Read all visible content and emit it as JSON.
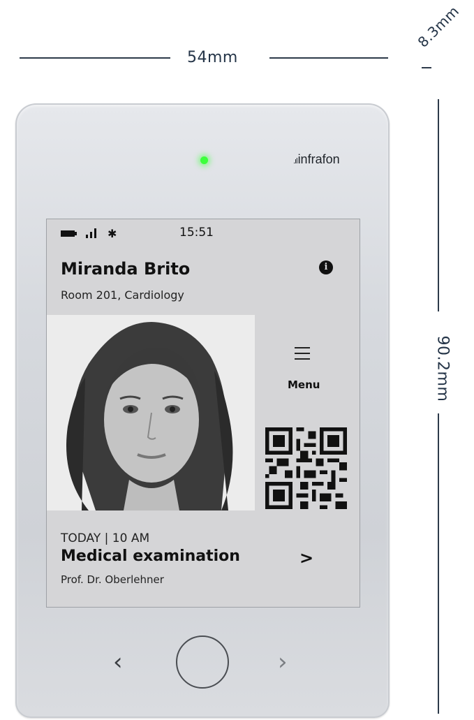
{
  "dimensions": {
    "width_label": "54mm",
    "depth_label": "8.3mm",
    "height_label": "90.2mm"
  },
  "device": {
    "brand": "infrafon",
    "led_color": "#3cff3c"
  },
  "screen": {
    "status_bar": {
      "icons": [
        "battery-icon",
        "signal-icon",
        "bluetooth-icon"
      ],
      "time": "15:51"
    },
    "patient": {
      "name": "Miranda Brito",
      "room": "Room 201, Cardiology"
    },
    "menu_label": "Menu",
    "appointment": {
      "when": "TODAY | 10 AM",
      "title": "Medical examination",
      "doctor": "Prof. Dr. Oberlehner"
    }
  },
  "hardware_buttons": [
    "previous-button",
    "home-button",
    "next-button"
  ]
}
